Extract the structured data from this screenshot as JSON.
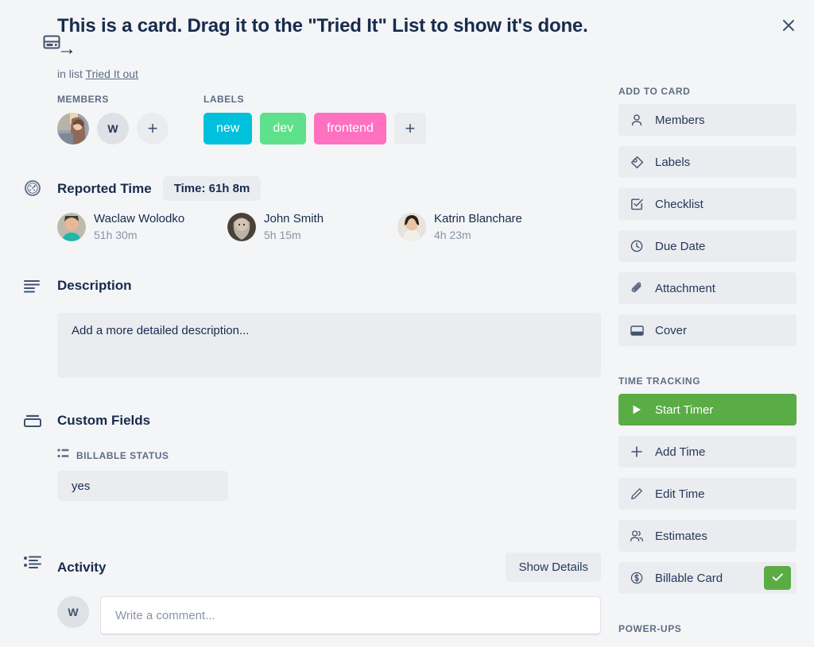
{
  "window": {
    "close_label": "×",
    "background": "#f4f5f7"
  },
  "card": {
    "title": "This is a card. Drag it to the \"Tried It\" List to show it's done. →",
    "in_list_prefix": "in list",
    "list_name": "Tried It out"
  },
  "members": {
    "heading": "MEMBERS",
    "avatars": [
      {
        "type": "photo",
        "name": "member-photo"
      },
      {
        "type": "initial",
        "initial": "W"
      }
    ],
    "add_label": "+"
  },
  "labels": {
    "heading": "LABELS",
    "items": [
      {
        "text": "new",
        "color": "#00c0db"
      },
      {
        "text": "dev",
        "color": "#5fe08a"
      },
      {
        "text": "frontend",
        "color": "#ff70c0"
      }
    ],
    "add_label": "+"
  },
  "reported_time": {
    "heading": "Reported Time",
    "total_badge": "Time: 61h 8m",
    "people": [
      {
        "name": "Waclaw Wolodko",
        "time": "51h 30m"
      },
      {
        "name": "John Smith",
        "time": "5h 15m"
      },
      {
        "name": "Katrin Blanchare",
        "time": "4h 23m"
      }
    ]
  },
  "description": {
    "heading": "Description",
    "placeholder": "Add a more detailed description..."
  },
  "custom_fields": {
    "heading": "Custom Fields",
    "fields": [
      {
        "label": "BILLABLE STATUS",
        "value": "yes"
      }
    ]
  },
  "activity": {
    "heading": "Activity",
    "show_details_label": "Show Details",
    "avatar_initial": "W",
    "comment_placeholder": "Write a comment..."
  },
  "sidebar": {
    "add_to_card": {
      "heading": "ADD TO CARD",
      "items": [
        {
          "label": "Members",
          "icon": "person-icon"
        },
        {
          "label": "Labels",
          "icon": "tag-icon"
        },
        {
          "label": "Checklist",
          "icon": "checkbox-icon"
        },
        {
          "label": "Due Date",
          "icon": "clock-icon"
        },
        {
          "label": "Attachment",
          "icon": "paperclip-icon"
        },
        {
          "label": "Cover",
          "icon": "cover-icon"
        }
      ]
    },
    "time_tracking": {
      "heading": "TIME TRACKING",
      "items": [
        {
          "label": "Start Timer",
          "icon": "play-icon",
          "primary": true
        },
        {
          "label": "Add Time",
          "icon": "plus-icon",
          "primary": false
        },
        {
          "label": "Edit Time",
          "icon": "pencil-icon",
          "primary": false
        },
        {
          "label": "Estimates",
          "icon": "people-icon",
          "primary": false
        },
        {
          "label": "Billable Card",
          "icon": "dollar-icon",
          "primary": false,
          "toggle": "on"
        }
      ],
      "accent_color": "#5aac44"
    },
    "power_ups": {
      "heading": "POWER-UPS"
    }
  }
}
